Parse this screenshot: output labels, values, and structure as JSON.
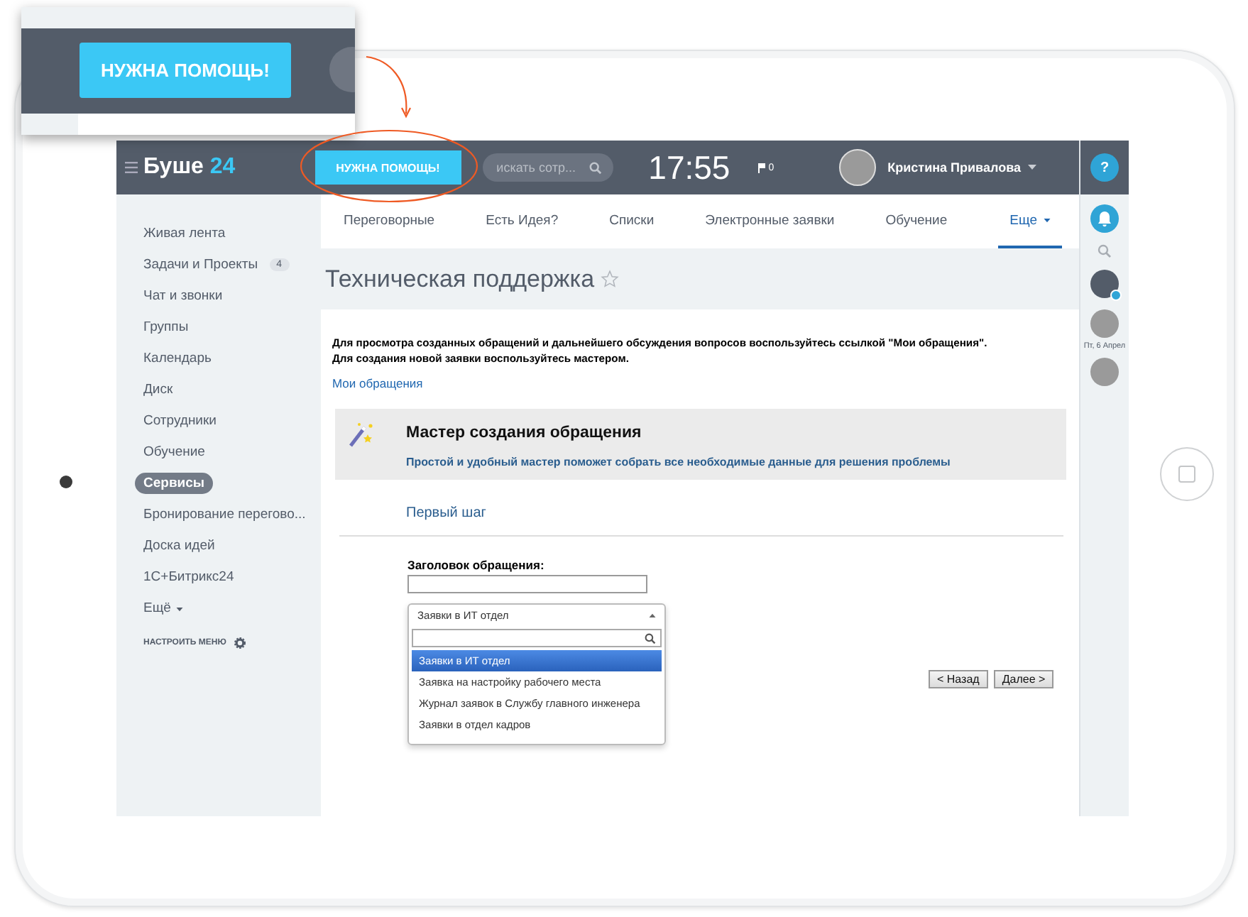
{
  "callout": {
    "button": "НУЖНА ПОМОЩЬ!"
  },
  "header": {
    "logo_text": "Буше",
    "logo_number": "24",
    "help_button": "НУЖНА ПОМОЩЬ!",
    "search": {
      "placeholder": "искать сотр..."
    },
    "time": "17:55",
    "flag_count": "0",
    "user_name": "Кристина Привалова"
  },
  "sidebar": {
    "items": [
      {
        "label": "Живая лента",
        "selected": false
      },
      {
        "label": "Задачи и Проекты",
        "counter": "4",
        "selected": false
      },
      {
        "label": "Чат и звонки",
        "selected": false
      },
      {
        "label": "Группы",
        "selected": false
      },
      {
        "label": "Календарь",
        "selected": false
      },
      {
        "label": "Диск",
        "selected": false
      },
      {
        "label": "Сотрудники",
        "selected": false
      },
      {
        "label": "Обучение",
        "selected": false
      },
      {
        "label": "Сервисы",
        "selected": true
      },
      {
        "label": "Бронирование перегово...",
        "selected": false
      },
      {
        "label": "Доска идей",
        "selected": false
      },
      {
        "label": "1С+Битрикс24",
        "selected": false
      }
    ],
    "more": "Ещё",
    "settings": "НАСТРОИТЬ МЕНЮ"
  },
  "tabs": [
    {
      "label": "Переговорные",
      "selected": false
    },
    {
      "label": "Есть Идея?",
      "selected": false
    },
    {
      "label": "Списки",
      "selected": false
    },
    {
      "label": "Электронные заявки",
      "selected": false
    },
    {
      "label": "Обучение",
      "selected": false
    },
    {
      "label": "Еще",
      "selected": true
    }
  ],
  "page_title": "Техническая поддержка",
  "intro": [
    "Для просмотра созданных обращений и дальнейшего обсуждения вопросов воспользуйтесь ссылкой \"Мои обращения\".",
    "Для создания новой заявки воспользуйтесь мастером."
  ],
  "my_requests_link": "Мои обращения",
  "wizard": {
    "title": "Мастер создания обращения",
    "subtitle": "Простой и удобный мастер поможет собрать все необходимые данные для решения проблемы",
    "step": "Первый шаг",
    "field_label": "Заголовок обращения:",
    "dropdown": {
      "value": "Заявки в ИТ отдел",
      "options": [
        {
          "label": "Заявки в ИТ отдел",
          "selected": true
        },
        {
          "label": "Заявка на настройку рабочего места",
          "selected": false
        },
        {
          "label": "Журнал заявок в Службу главного инженера",
          "selected": false
        },
        {
          "label": "Заявки в отдел кадров",
          "selected": false
        }
      ]
    },
    "buttons": [
      "< Назад",
      "Далее >"
    ]
  },
  "right_bar": {
    "help": "?",
    "date": "Пт, 6 Апрел"
  }
}
